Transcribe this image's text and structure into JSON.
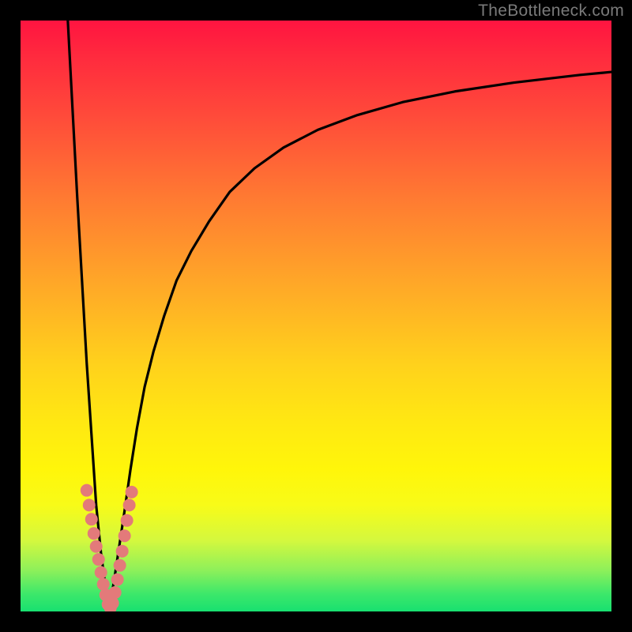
{
  "watermark": "TheBottleneck.com",
  "chart_data": {
    "type": "line",
    "title": "",
    "xlabel": "",
    "ylabel": "",
    "xlim": [
      0,
      100
    ],
    "ylim": [
      0,
      100
    ],
    "grid": false,
    "legend": false,
    "note": "Axes are unlabeled; values are estimated from pixel positions (0–100 plot-relative).",
    "series": [
      {
        "name": "left-branch",
        "x": [
          8.0,
          8.8,
          9.6,
          10.4,
          11.2,
          12.0,
          12.8,
          13.6,
          14.4,
          14.9
        ],
        "y": [
          100,
          85,
          70,
          56,
          42,
          30,
          18,
          10,
          4,
          0
        ]
      },
      {
        "name": "right-branch",
        "x": [
          14.9,
          15.8,
          16.7,
          17.6,
          18.6,
          19.7,
          21.0,
          22.5,
          24.3,
          26.4,
          28.9,
          31.9,
          35.4,
          39.6,
          44.5,
          50.3,
          57.0,
          64.7,
          73.5,
          83.5,
          94.7,
          100.0
        ],
        "y": [
          0,
          5,
          11,
          17,
          24,
          31,
          38,
          44,
          50,
          56,
          61,
          66,
          71,
          75,
          78.5,
          81.5,
          84,
          86.2,
          88,
          89.5,
          90.8,
          91.3
        ]
      }
    ],
    "markers": {
      "name": "dots",
      "color": "#e37a7a",
      "points": [
        {
          "x": 11.2,
          "y": 20.5
        },
        {
          "x": 11.6,
          "y": 18.0
        },
        {
          "x": 12.0,
          "y": 15.6
        },
        {
          "x": 12.4,
          "y": 13.2
        },
        {
          "x": 12.8,
          "y": 11.0
        },
        {
          "x": 13.2,
          "y": 8.8
        },
        {
          "x": 13.6,
          "y": 6.6
        },
        {
          "x": 14.0,
          "y": 4.6
        },
        {
          "x": 14.4,
          "y": 2.8
        },
        {
          "x": 14.8,
          "y": 1.2
        },
        {
          "x": 15.2,
          "y": 0.6
        },
        {
          "x": 15.6,
          "y": 1.4
        },
        {
          "x": 16.0,
          "y": 3.2
        },
        {
          "x": 16.4,
          "y": 5.4
        },
        {
          "x": 16.8,
          "y": 7.8
        },
        {
          "x": 17.2,
          "y": 10.2
        },
        {
          "x": 17.6,
          "y": 12.8
        },
        {
          "x": 18.0,
          "y": 15.4
        },
        {
          "x": 18.4,
          "y": 18.0
        },
        {
          "x": 18.8,
          "y": 20.2
        }
      ]
    },
    "gradient_stops": [
      {
        "pos": 0.0,
        "color": "#ff1440"
      },
      {
        "pos": 0.3,
        "color": "#ff7a32"
      },
      {
        "pos": 0.58,
        "color": "#ffd11c"
      },
      {
        "pos": 0.82,
        "color": "#d4f83e"
      },
      {
        "pos": 1.0,
        "color": "#18e070"
      }
    ]
  }
}
